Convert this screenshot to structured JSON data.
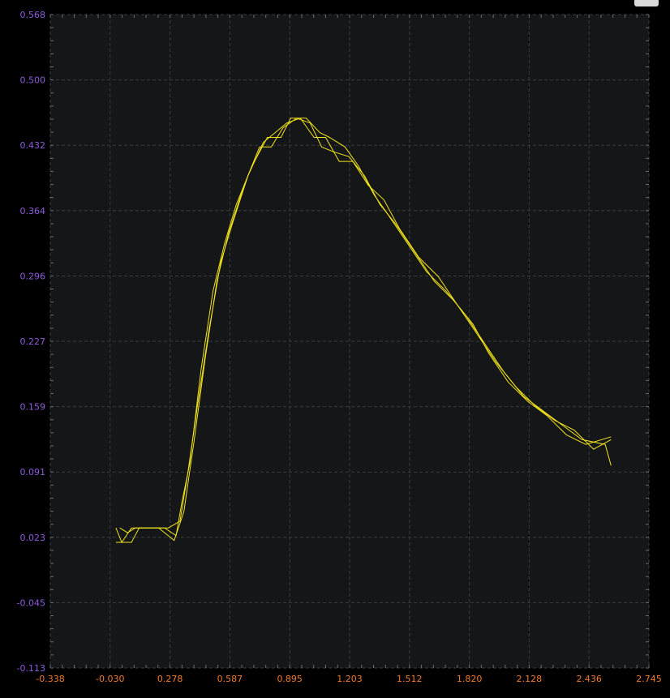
{
  "chart_data": {
    "type": "line",
    "title": "",
    "xlabel": "",
    "ylabel": "",
    "xlim": [
      -0.338,
      2.745
    ],
    "ylim": [
      -0.113,
      0.568
    ],
    "x_ticks": [
      "-0.338",
      "-0.030",
      "0.278",
      "0.587",
      "0.895",
      "1.203",
      "1.512",
      "1.820",
      "2.128",
      "2.436",
      "2.745"
    ],
    "y_ticks": [
      "0.568",
      "0.500",
      "0.432",
      "0.364",
      "0.296",
      "0.227",
      "0.159",
      "0.091",
      "0.023",
      "-0.045",
      "-0.113"
    ],
    "grid": true,
    "legend": "none",
    "colors": {
      "background": "#141618",
      "grid": "#3a3d40",
      "line": "#f2e31e",
      "y_ticks": "#8f5bd9",
      "x_ticks": "#f07a28"
    },
    "series": [
      {
        "values": [
          [
            0.0,
            0.033
          ],
          [
            0.03,
            0.018
          ],
          [
            0.08,
            0.033
          ],
          [
            0.25,
            0.033
          ],
          [
            0.31,
            0.025
          ],
          [
            0.34,
            0.06
          ],
          [
            0.38,
            0.1
          ],
          [
            0.44,
            0.2
          ],
          [
            0.5,
            0.28
          ],
          [
            0.56,
            0.33
          ],
          [
            0.62,
            0.37
          ],
          [
            0.7,
            0.41
          ],
          [
            0.78,
            0.44
          ],
          [
            0.85,
            0.44
          ],
          [
            0.9,
            0.46
          ],
          [
            0.98,
            0.46
          ],
          [
            1.05,
            0.445
          ],
          [
            1.1,
            0.44
          ],
          [
            1.18,
            0.43
          ],
          [
            1.25,
            0.41
          ],
          [
            1.33,
            0.38
          ],
          [
            1.4,
            0.36
          ],
          [
            1.5,
            0.33
          ],
          [
            1.6,
            0.3
          ],
          [
            1.7,
            0.28
          ],
          [
            1.8,
            0.255
          ],
          [
            1.9,
            0.225
          ],
          [
            2.0,
            0.195
          ],
          [
            2.1,
            0.17
          ],
          [
            2.2,
            0.155
          ],
          [
            2.3,
            0.14
          ],
          [
            2.4,
            0.125
          ],
          [
            2.52,
            0.12
          ],
          [
            2.55,
            0.098
          ]
        ]
      },
      {
        "values": [
          [
            0.0,
            0.018
          ],
          [
            0.08,
            0.018
          ],
          [
            0.12,
            0.033
          ],
          [
            0.22,
            0.033
          ],
          [
            0.3,
            0.02
          ],
          [
            0.35,
            0.05
          ],
          [
            0.4,
            0.12
          ],
          [
            0.46,
            0.21
          ],
          [
            0.52,
            0.29
          ],
          [
            0.58,
            0.34
          ],
          [
            0.66,
            0.39
          ],
          [
            0.74,
            0.43
          ],
          [
            0.8,
            0.43
          ],
          [
            0.86,
            0.45
          ],
          [
            0.93,
            0.46
          ],
          [
            1.0,
            0.455
          ],
          [
            1.06,
            0.43
          ],
          [
            1.12,
            0.425
          ],
          [
            1.2,
            0.42
          ],
          [
            1.28,
            0.4
          ],
          [
            1.36,
            0.37
          ],
          [
            1.44,
            0.35
          ],
          [
            1.54,
            0.32
          ],
          [
            1.64,
            0.29
          ],
          [
            1.74,
            0.27
          ],
          [
            1.84,
            0.245
          ],
          [
            1.92,
            0.215
          ],
          [
            2.02,
            0.185
          ],
          [
            2.12,
            0.165
          ],
          [
            2.22,
            0.15
          ],
          [
            2.32,
            0.13
          ],
          [
            2.42,
            0.12
          ],
          [
            2.55,
            0.128
          ]
        ]
      },
      {
        "values": [
          [
            0.02,
            0.033
          ],
          [
            0.06,
            0.028
          ],
          [
            0.1,
            0.033
          ],
          [
            0.27,
            0.033
          ],
          [
            0.33,
            0.04
          ],
          [
            0.37,
            0.09
          ],
          [
            0.42,
            0.16
          ],
          [
            0.48,
            0.24
          ],
          [
            0.54,
            0.31
          ],
          [
            0.6,
            0.35
          ],
          [
            0.68,
            0.4
          ],
          [
            0.76,
            0.435
          ],
          [
            0.82,
            0.445
          ],
          [
            0.88,
            0.455
          ],
          [
            0.95,
            0.46
          ],
          [
            1.02,
            0.44
          ],
          [
            1.08,
            0.44
          ],
          [
            1.15,
            0.415
          ],
          [
            1.22,
            0.415
          ],
          [
            1.3,
            0.39
          ],
          [
            1.38,
            0.375
          ],
          [
            1.46,
            0.345
          ],
          [
            1.56,
            0.315
          ],
          [
            1.66,
            0.295
          ],
          [
            1.76,
            0.265
          ],
          [
            1.86,
            0.235
          ],
          [
            1.96,
            0.205
          ],
          [
            2.06,
            0.18
          ],
          [
            2.16,
            0.16
          ],
          [
            2.26,
            0.145
          ],
          [
            2.36,
            0.135
          ],
          [
            2.46,
            0.115
          ],
          [
            2.55,
            0.125
          ]
        ]
      }
    ]
  }
}
